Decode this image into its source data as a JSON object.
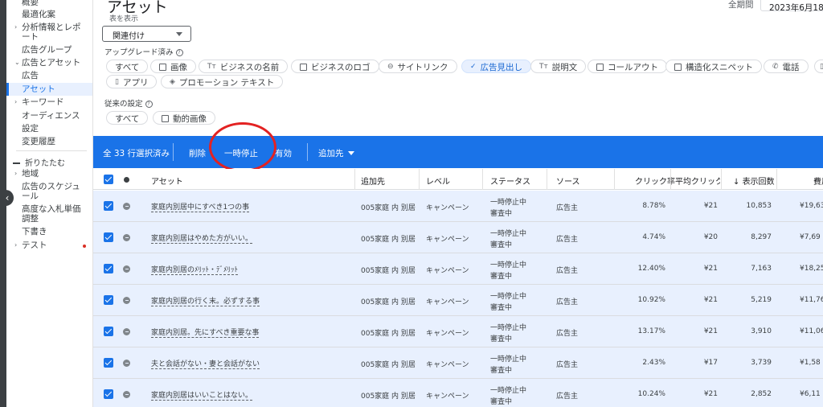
{
  "sidebar": {
    "items": [
      {
        "label": "概要",
        "caret": false,
        "active": false
      },
      {
        "label": "最適化案",
        "caret": false,
        "active": false
      },
      {
        "label": "分析情報とレポート",
        "caret": true,
        "active": false
      },
      {
        "label": "広告グループ",
        "caret": false,
        "active": false
      },
      {
        "label": "広告とアセット",
        "caret": true,
        "active": false
      },
      {
        "label": "広告",
        "caret": false,
        "active": false
      },
      {
        "label": "アセット",
        "caret": false,
        "active": true
      },
      {
        "label": "キーワード",
        "caret": true,
        "active": false
      },
      {
        "label": "オーディエンス",
        "caret": false,
        "active": false
      },
      {
        "label": "設定",
        "caret": false,
        "active": false
      },
      {
        "label": "変更履歴",
        "caret": false,
        "active": false
      }
    ],
    "collapse_label": "折りたたむ",
    "lower_items": [
      {
        "label": "地域",
        "caret": true
      },
      {
        "label": "広告のスケジュール",
        "caret": false
      },
      {
        "label": "高度な入札単価調整",
        "caret": false
      },
      {
        "label": "下書き",
        "caret": false
      },
      {
        "label": "テスト",
        "caret": true
      }
    ]
  },
  "header": {
    "title": "アセット",
    "period_label": "全期間",
    "date_value": "2023年6月18日"
  },
  "view": {
    "show_label": "表を表示",
    "select_value": "関連付け"
  },
  "upgraded": {
    "label": "アップグレード済み",
    "chips": [
      {
        "label": "すべて",
        "icon": "",
        "selected": false
      },
      {
        "label": "画像",
        "icon": "image-icon",
        "selected": false
      },
      {
        "label": "ビジネスの名前",
        "icon": "text-icon",
        "selected": false
      },
      {
        "label": "ビジネスのロゴ",
        "icon": "image-icon",
        "selected": false
      },
      {
        "label": "サイトリンク",
        "icon": "link-icon",
        "selected": false
      },
      {
        "label": "広告見出し",
        "icon": "check-icon",
        "selected": true
      },
      {
        "label": "説明文",
        "icon": "text-icon",
        "selected": false
      },
      {
        "label": "コールアウト",
        "icon": "callout-icon",
        "selected": false
      },
      {
        "label": "構造化スニペット",
        "icon": "snippet-icon",
        "selected": false
      },
      {
        "label": "電話",
        "icon": "phone-icon",
        "selected": false
      },
      {
        "label": "",
        "icon": "more-icon",
        "selected": false
      },
      {
        "label": "アプリ",
        "icon": "mobile-icon",
        "selected": false
      },
      {
        "label": "プロモーション テキスト",
        "icon": "promotion-icon",
        "selected": false
      }
    ]
  },
  "legacy": {
    "label": "従来の設定",
    "chips": [
      {
        "label": "すべて",
        "icon": "",
        "selected": false
      },
      {
        "label": "動的画像",
        "icon": "image-icon",
        "selected": false
      }
    ]
  },
  "action_bar": {
    "selected_count": "全 33 行選択済み",
    "delete": "削除",
    "pause": "一時停止",
    "enable": "有効",
    "add_to": "追加先"
  },
  "table": {
    "headers": {
      "asset": "アセット",
      "added_to": "追加先",
      "level": "レベル",
      "status": "ステータス",
      "source": "ソース",
      "ctr": "クリック率",
      "avg_cpc": "平均クリック単",
      "impressions": "表示回数",
      "cost": "費用"
    },
    "rows": [
      {
        "asset": "家庭内別居中にすべき1つの事",
        "added_to": "005家庭 内 別居",
        "level": "キャンペーン",
        "status1": "一時停止中",
        "status2": "審査中",
        "source": "広告主",
        "ctr": "8.78%",
        "cpc": "¥21",
        "impr": "10,853",
        "cost": "¥19,63"
      },
      {
        "asset": "家庭内別居はやめた方がいい。",
        "added_to": "005家庭 内 別居",
        "level": "キャンペーン",
        "status1": "一時停止中",
        "status2": "審査中",
        "source": "広告主",
        "ctr": "4.74%",
        "cpc": "¥20",
        "impr": "8,297",
        "cost": "¥7,69"
      },
      {
        "asset": "家庭内別居のﾒﾘｯﾄ・ﾃﾞﾒﾘｯﾄ",
        "added_to": "005家庭 内 別居",
        "level": "キャンペーン",
        "status1": "一時停止中",
        "status2": "審査中",
        "source": "広告主",
        "ctr": "12.40%",
        "cpc": "¥21",
        "impr": "7,163",
        "cost": "¥18,25"
      },
      {
        "asset": "家庭内別居の行く末。必ずする事",
        "added_to": "005家庭 内 別居",
        "level": "キャンペーン",
        "status1": "一時停止中",
        "status2": "審査中",
        "source": "広告主",
        "ctr": "10.92%",
        "cpc": "¥21",
        "impr": "5,219",
        "cost": "¥11,76"
      },
      {
        "asset": "家庭内別居。先にすべき重要な事",
        "added_to": "005家庭 内 別居",
        "level": "キャンペーン",
        "status1": "一時停止中",
        "status2": "審査中",
        "source": "広告主",
        "ctr": "13.17%",
        "cpc": "¥21",
        "impr": "3,910",
        "cost": "¥11,06"
      },
      {
        "asset": "夫と会話がない・妻と会話がない",
        "added_to": "005家庭 内 別居",
        "level": "キャンペーン",
        "status1": "一時停止中",
        "status2": "審査中",
        "source": "広告主",
        "ctr": "2.43%",
        "cpc": "¥17",
        "impr": "3,739",
        "cost": "¥1,58"
      },
      {
        "asset": "家庭内別居はいいことはない。",
        "added_to": "005家庭 内 別居",
        "level": "キャンペーン",
        "status1": "一時停止中",
        "status2": "審査中",
        "source": "広告主",
        "ctr": "10.24%",
        "cpc": "¥21",
        "impr": "2,852",
        "cost": "¥6,11"
      }
    ]
  },
  "colors": {
    "accent": "#1a73e8",
    "row_selected": "#e8f0fe",
    "annotation": "#e32222"
  }
}
